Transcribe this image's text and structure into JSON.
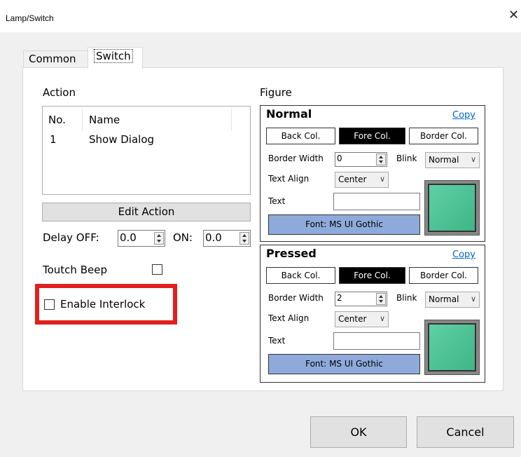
{
  "window": {
    "title": "Lamp/Switch",
    "close_glyph": "✕"
  },
  "tabs": [
    {
      "label": "Common",
      "selected": false
    },
    {
      "label": "Switch",
      "selected": true
    }
  ],
  "action": {
    "section_label": "Action",
    "columns": [
      "No.",
      "Name"
    ],
    "rows": [
      {
        "no": "1",
        "name": "Show Dialog"
      }
    ],
    "edit_button": "Edit Action"
  },
  "delay": {
    "off_label": "Delay OFF:",
    "off_value": "0.0",
    "on_label": "ON:",
    "on_value": "0.0"
  },
  "touch_beep": {
    "label": "Toutch Beep",
    "checked": false
  },
  "interlock": {
    "label": "Enable Interlock",
    "checked": false,
    "highlight_color": "#e0201e"
  },
  "figure": {
    "section_label": "Figure",
    "normal": {
      "title": "Normal",
      "copy_link": "Copy",
      "back_col": "Back Col.",
      "fore_col": "Fore Col.",
      "border_col": "Border Col.",
      "border_width_label": "Border Width",
      "border_width_value": "0",
      "blink_label": "Blink",
      "blink_value": "Normal",
      "text_align_label": "Text Align",
      "text_align_value": "Center",
      "text_label": "Text",
      "text_value": "",
      "font_button": "Font: MS UI Gothic",
      "preview_color": "#4cc496"
    },
    "pressed": {
      "title": "Pressed",
      "copy_link": "Copy",
      "back_col": "Back Col.",
      "fore_col": "Fore Col.",
      "border_col": "Border Col.",
      "border_width_label": "Border Width",
      "border_width_value": "2",
      "blink_label": "Blink",
      "blink_value": "Normal",
      "text_align_label": "Text Align",
      "text_align_value": "Center",
      "text_label": "Text",
      "text_value": "",
      "font_button": "Font: MS UI Gothic",
      "preview_color": "#4cc496"
    }
  },
  "buttons": {
    "ok": "OK",
    "cancel": "Cancel"
  },
  "icons": {
    "combo_chevron": "∨"
  }
}
